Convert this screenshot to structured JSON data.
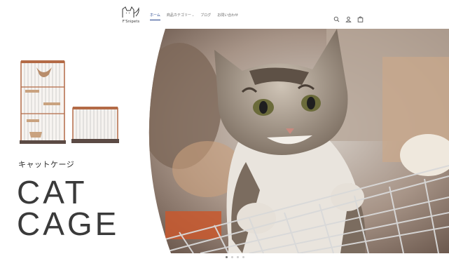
{
  "header": {
    "logo_text": "F'Snipets",
    "nav": [
      {
        "label": "ホーム",
        "active": true,
        "has_menu": false
      },
      {
        "label": "商品カテゴリー",
        "active": false,
        "has_menu": true
      },
      {
        "label": "ブログ",
        "active": false,
        "has_menu": false
      },
      {
        "label": "お問い合わせ",
        "active": false,
        "has_menu": false
      }
    ],
    "icons": [
      "search-icon",
      "account-icon",
      "cart-icon"
    ],
    "accent_color": "#1e3e8a"
  },
  "hero": {
    "kana_title": "キャットケージ",
    "title_line1": "CAT",
    "title_line2": "CAGE"
  },
  "slider": {
    "slide_count": 4,
    "active_index": 0
  }
}
